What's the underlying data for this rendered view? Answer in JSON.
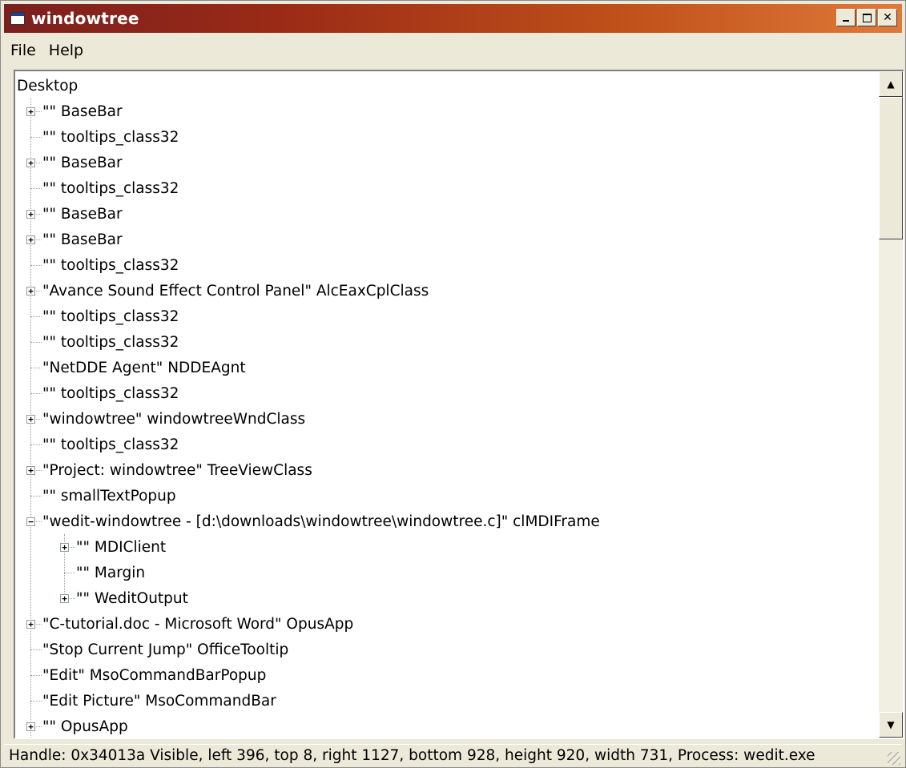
{
  "window": {
    "title": "windowtree",
    "icon": "app-window-icon",
    "buttons": {
      "minimize": "minimize-icon",
      "maximize": "maximize-icon",
      "close": "close-icon"
    }
  },
  "menubar": {
    "items": [
      "File",
      "Help"
    ]
  },
  "tree": {
    "root": "Desktop",
    "nodes": [
      {
        "label": "\"\" BaseBar",
        "level": 1,
        "expander": "plus"
      },
      {
        "label": "\"\" tooltips_class32",
        "level": 1,
        "expander": "none"
      },
      {
        "label": "\"\" BaseBar",
        "level": 1,
        "expander": "plus"
      },
      {
        "label": "\"\" tooltips_class32",
        "level": 1,
        "expander": "none"
      },
      {
        "label": "\"\" BaseBar",
        "level": 1,
        "expander": "plus"
      },
      {
        "label": "\"\" BaseBar",
        "level": 1,
        "expander": "plus"
      },
      {
        "label": "\"\" tooltips_class32",
        "level": 1,
        "expander": "none"
      },
      {
        "label": "\"Avance Sound Effect Control Panel\" AlcEaxCplClass",
        "level": 1,
        "expander": "plus"
      },
      {
        "label": "\"\" tooltips_class32",
        "level": 1,
        "expander": "none"
      },
      {
        "label": "\"\" tooltips_class32",
        "level": 1,
        "expander": "none"
      },
      {
        "label": "\"NetDDE Agent\" NDDEAgnt",
        "level": 1,
        "expander": "none"
      },
      {
        "label": "\"\" tooltips_class32",
        "level": 1,
        "expander": "none"
      },
      {
        "label": "\"windowtree\" windowtreeWndClass",
        "level": 1,
        "expander": "plus"
      },
      {
        "label": "\"\" tooltips_class32",
        "level": 1,
        "expander": "none"
      },
      {
        "label": "\"Project: windowtree\" TreeViewClass",
        "level": 1,
        "expander": "plus"
      },
      {
        "label": "\"\" smallTextPopup",
        "level": 1,
        "expander": "none"
      },
      {
        "label": "\"wedit-windowtree - [d:\\downloads\\windowtree\\windowtree.c]\" clMDIFrame",
        "level": 1,
        "expander": "minus"
      },
      {
        "label": "\"\" MDIClient",
        "level": 2,
        "expander": "plus"
      },
      {
        "label": "\"\" Margin",
        "level": 2,
        "expander": "none"
      },
      {
        "label": "\"\" WeditOutput",
        "level": 2,
        "expander": "plus"
      },
      {
        "label": "\"C-tutorial.doc - Microsoft Word\" OpusApp",
        "level": 1,
        "expander": "plus"
      },
      {
        "label": "\"Stop Current Jump\" OfficeTooltip",
        "level": 1,
        "expander": "none"
      },
      {
        "label": "\"Edit\" MsoCommandBarPopup",
        "level": 1,
        "expander": "none"
      },
      {
        "label": "\"Edit Picture\" MsoCommandBar",
        "level": 1,
        "expander": "none"
      },
      {
        "label": "\"\" OpusApp",
        "level": 1,
        "expander": "plus"
      }
    ]
  },
  "scrollbar": {
    "up": "scroll-up-arrow-icon",
    "down": "scroll-down-arrow-icon",
    "position": 0.0
  },
  "statusbar": {
    "text": "Handle: 0x34013a Visible, left 396, top 8, right 1127, bottom 928, height 920, width 731, Process: wedit.exe"
  }
}
